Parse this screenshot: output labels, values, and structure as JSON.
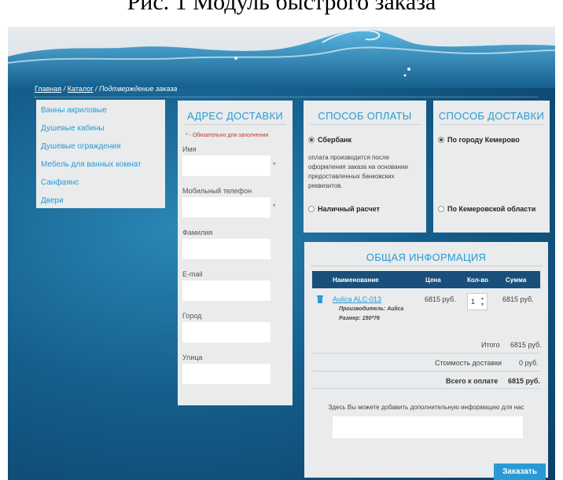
{
  "caption": "Рис. 1 Модуль быстрого заказа",
  "breadcrumb": {
    "home": "Главная",
    "sep1": " / ",
    "catalog": "Каталог",
    "sep2": " / ",
    "current": "Подтверждение заказа"
  },
  "categories": [
    "Ванны акриловые",
    "Душевые кабины",
    "Душевые ограждения",
    "Мебель для ванных комнат",
    "Санфаянс",
    "Двери"
  ],
  "address": {
    "title": "АДРЕС ДОСТАВКИ",
    "required_note": "* - Обязательно для заполнения",
    "fields": [
      {
        "label": "Имя",
        "required": "*"
      },
      {
        "label": "Мобильный телефон",
        "required": "*"
      },
      {
        "label": "Фамилия",
        "required": ""
      },
      {
        "label": "E-mail",
        "required": ""
      },
      {
        "label": "Город",
        "required": ""
      },
      {
        "label": "Улица",
        "required": ""
      }
    ]
  },
  "payment": {
    "title": "СПОСОБ ОПЛАТЫ",
    "option1": "Сбербанк",
    "description": "оплата производится после оформления заказа на основании предоставленных банковских реквизитов.",
    "option2": "Наличный расчет"
  },
  "delivery": {
    "title": "СПОСОБ ДОСТАВКИ",
    "option1": "По городу Кемерово",
    "option2": "По Кемеровской области"
  },
  "info": {
    "title": "ОБЩАЯ ИНФОРМАЦИЯ",
    "headers": {
      "name": "Наименование",
      "price": "Цена",
      "qty": "Кол-во",
      "sum": "Сумма"
    },
    "item": {
      "name": "Aulica ALC-013",
      "maker": "Производитель: Aulica",
      "size": "Размер: 150*76",
      "price": "6815 руб.",
      "qty": "1",
      "sum": "6815 руб."
    },
    "total_label": "Итого",
    "total_value": "6815 руб.",
    "delivery_label": "Стоимость доставки",
    "delivery_value": "0 руб.",
    "pay_label": "Всего к оплате",
    "pay_value": "6815 руб.",
    "comment_label": "Здесь Вы можете добавить дополнительную информацию для нас"
  },
  "order_button": "Заказать",
  "colors": {
    "accent": "#2a9ad4",
    "header_dark": "#194f7a",
    "panel": "#e9ebec"
  }
}
